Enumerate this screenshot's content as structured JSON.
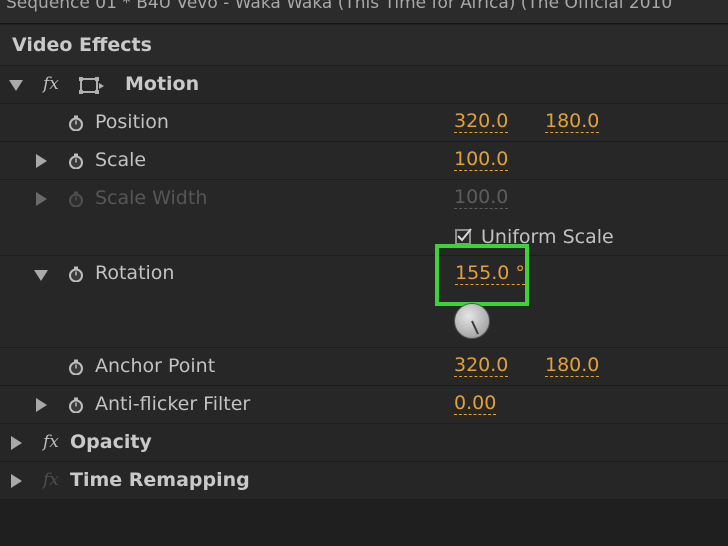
{
  "window": {
    "title": "Sequence 01 * B4U Vevo - Waka Waka (This Time for Africa) (The Official 2010"
  },
  "panel": {
    "title": "Video Effects"
  },
  "effects": {
    "motion": {
      "label": "Motion",
      "fx": "fx",
      "position": {
        "label": "Position",
        "x": "320.0",
        "y": "180.0"
      },
      "scale": {
        "label": "Scale",
        "value": "100.0"
      },
      "scale_width": {
        "label": "Scale Width",
        "value": "100.0"
      },
      "uniform_scale": {
        "label": "Uniform Scale",
        "checked": true
      },
      "rotation": {
        "label": "Rotation",
        "value": "155.0 °"
      },
      "anchor_point": {
        "label": "Anchor Point",
        "x": "320.0",
        "y": "180.0"
      },
      "anti_flicker": {
        "label": "Anti-flicker Filter",
        "value": "0.00"
      }
    },
    "opacity": {
      "label": "Opacity",
      "fx": "fx"
    },
    "time_remapping": {
      "label": "Time Remapping",
      "fx": "fx"
    }
  },
  "colors": {
    "value": "#e0a13a",
    "highlight": "#3fd13a",
    "background": "#1f1f1f"
  },
  "icons": [
    "twirl-down-icon",
    "twirl-right-icon",
    "fx-icon",
    "transform-box-icon",
    "stopwatch-icon",
    "checkbox-checked-icon",
    "rotation-dial-icon"
  ]
}
